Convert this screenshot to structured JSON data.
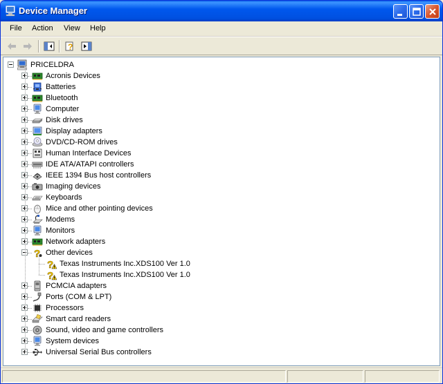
{
  "window": {
    "title": "Device Manager",
    "title_icon": "computer-icon"
  },
  "menu": [
    "File",
    "Action",
    "View",
    "Help"
  ],
  "toolbar": [
    "back-arrow-icon",
    "forward-arrow-icon",
    "show-hide-tree-icon",
    "properties-help-icon",
    "scan-changes-icon"
  ],
  "tree": {
    "root": {
      "label": "PRICELDRA",
      "icon": "computer-icon",
      "expanded": true
    },
    "categories": [
      {
        "label": "Acronis Devices",
        "icon": "circuit-board-icon"
      },
      {
        "label": "Batteries",
        "icon": "battery-icon"
      },
      {
        "label": "Bluetooth",
        "icon": "circuit-board-icon"
      },
      {
        "label": "Computer",
        "icon": "monitor-icon"
      },
      {
        "label": "Disk drives",
        "icon": "disk-drive-icon"
      },
      {
        "label": "Display adapters",
        "icon": "display-adapter-icon"
      },
      {
        "label": "DVD/CD-ROM drives",
        "icon": "cd-drive-icon"
      },
      {
        "label": "Human Interface Devices",
        "icon": "hid-icon"
      },
      {
        "label": "IDE ATA/ATAPI controllers",
        "icon": "ide-controller-icon"
      },
      {
        "label": "IEEE 1394 Bus host controllers",
        "icon": "ieee1394-icon"
      },
      {
        "label": "Imaging devices",
        "icon": "camera-icon"
      },
      {
        "label": "Keyboards",
        "icon": "keyboard-icon"
      },
      {
        "label": "Mice and other pointing devices",
        "icon": "mouse-icon"
      },
      {
        "label": "Modems",
        "icon": "modem-icon"
      },
      {
        "label": "Monitors",
        "icon": "monitor-icon"
      },
      {
        "label": "Network adapters",
        "icon": "circuit-board-icon"
      },
      {
        "label": "Other devices",
        "icon": "question-mark-icon",
        "expanded": true,
        "children": [
          {
            "label": "Texas Instruments Inc.XDS100 Ver 1.0",
            "icon": "warning-device-icon"
          },
          {
            "label": "Texas Instruments Inc.XDS100 Ver 1.0",
            "icon": "warning-device-icon"
          }
        ]
      },
      {
        "label": "PCMCIA adapters",
        "icon": "pcmcia-icon"
      },
      {
        "label": "Ports (COM & LPT)",
        "icon": "port-icon"
      },
      {
        "label": "Processors",
        "icon": "processor-icon"
      },
      {
        "label": "Smart card readers",
        "icon": "smart-card-icon"
      },
      {
        "label": "Sound, video and game controllers",
        "icon": "sound-icon"
      },
      {
        "label": "System devices",
        "icon": "monitor-icon"
      },
      {
        "label": "Universal Serial Bus controllers",
        "icon": "usb-icon"
      }
    ]
  },
  "colors": {
    "titlebar": "#0058EE",
    "accent": "#316AC5",
    "warning": "#FFD400"
  }
}
